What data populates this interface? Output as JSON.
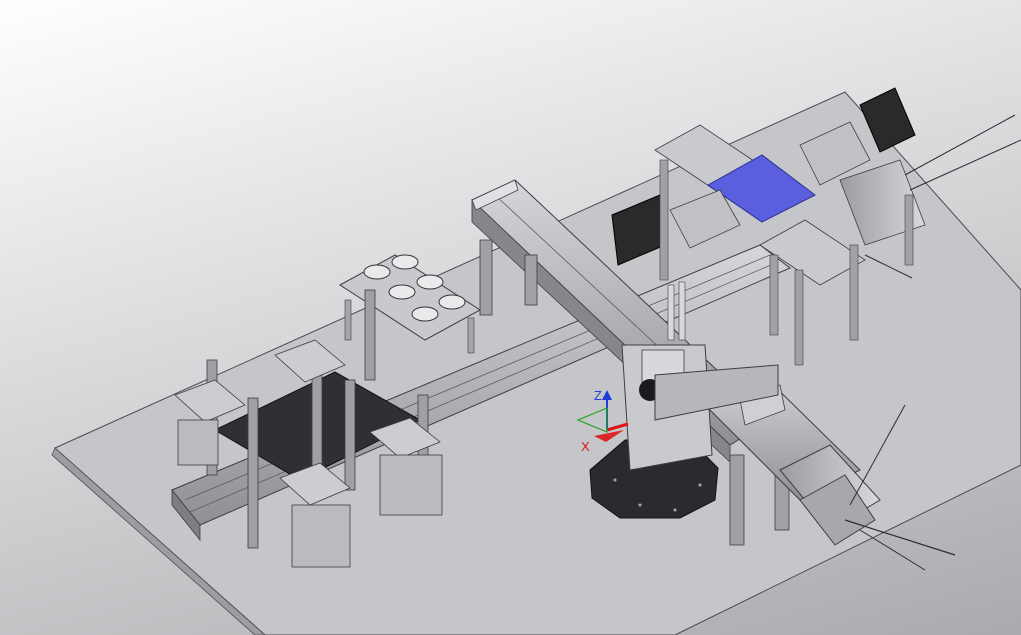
{
  "viewport": {
    "background_top": "#ffffff",
    "background_bottom": "#a9aaad"
  },
  "triad": {
    "z_label": "Z",
    "x_label": "X",
    "z_color": "#1f3bd8",
    "x_color": "#e01515",
    "y_color": "#22a322"
  },
  "colors": {
    "base_plate": "#c4c6c9",
    "metal": "#b8bac0",
    "metal_dark": "#8f9197",
    "motor": "#2a2a2a",
    "highlight_plate": "#5a5fe0",
    "dark_plate": "#2f3033"
  }
}
